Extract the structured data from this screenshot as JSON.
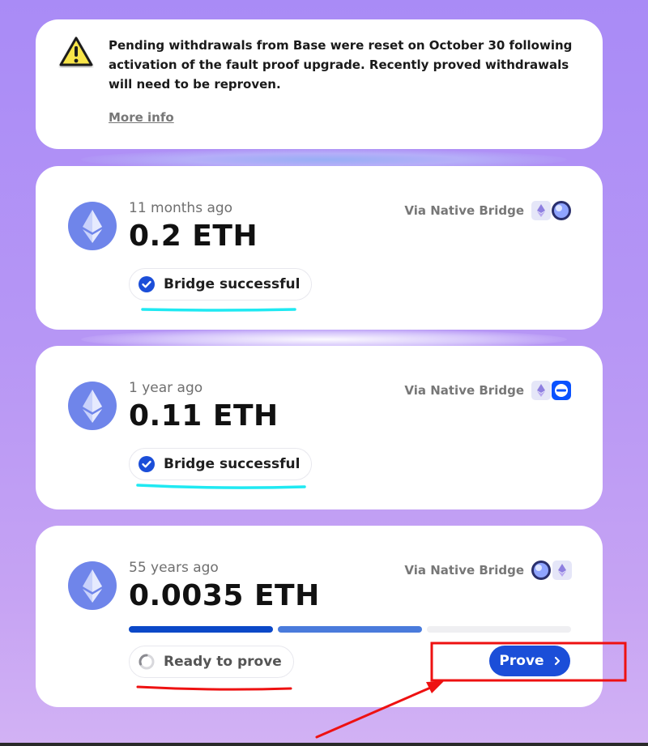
{
  "notice": {
    "message": "Pending withdrawals from Base were reset on October 30 following activation of the fault proof upgrade. Recently proved withdrawals will need to be reproven.",
    "more_info_label": "More info",
    "icon": "warning-triangle-icon"
  },
  "transactions": [
    {
      "time": "11 months ago",
      "amount": "0.2 ETH",
      "via": "Via Native Bridge",
      "status": "Bridge successful",
      "status_icon": "check-circle-icon"
    },
    {
      "time": "1 year ago",
      "amount": "0.11 ETH",
      "via": "Via Native Bridge",
      "status": "Bridge successful",
      "status_icon": "check-circle-icon"
    },
    {
      "time": "55 years ago",
      "amount": "0.0035 ETH",
      "via": "Via Native Bridge",
      "status": "Ready to prove",
      "status_icon": "spinner-icon",
      "progress_steps_complete": 2,
      "progress_steps_total": 3,
      "action_label": "Prove"
    }
  ],
  "colors": {
    "background_top": "#a98bf6",
    "background_bottom": "#d2b2f4",
    "accent_blue": "#1b4ed8",
    "progress_done": "#0b48c8",
    "progress_active": "#4a7bdc",
    "progress_pending": "#efeff2",
    "eth_logo_bg": "#6f85ea",
    "annotation_cyan": "#1fe9f2",
    "annotation_red": "#ee1111"
  }
}
